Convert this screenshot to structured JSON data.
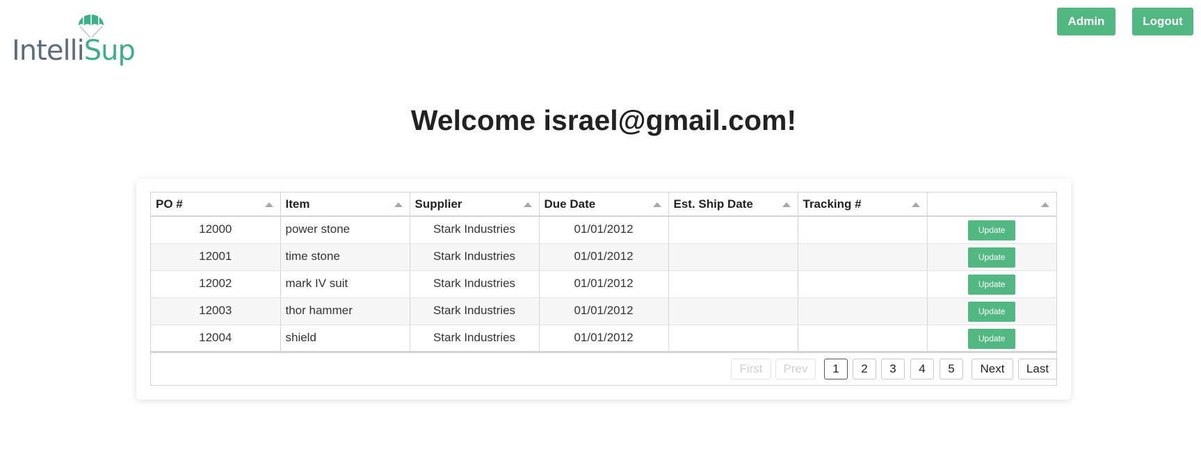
{
  "header": {
    "logo_part1": "Intelli",
    "logo_part2": "Sup",
    "admin_label": "Admin",
    "logout_label": "Logout"
  },
  "welcome": "Welcome israel@gmail.com!",
  "table": {
    "columns": [
      "PO #",
      "Item",
      "Supplier",
      "Due Date",
      "Est. Ship Date",
      "Tracking #",
      ""
    ],
    "rows": [
      {
        "po": "12000",
        "item": "power stone",
        "supplier": "Stark Industries",
        "due": "01/01/2012",
        "ship": "",
        "tracking": "",
        "action": "Update"
      },
      {
        "po": "12001",
        "item": "time stone",
        "supplier": "Stark Industries",
        "due": "01/01/2012",
        "ship": "",
        "tracking": "",
        "action": "Update"
      },
      {
        "po": "12002",
        "item": "mark IV suit",
        "supplier": "Stark Industries",
        "due": "01/01/2012",
        "ship": "",
        "tracking": "",
        "action": "Update"
      },
      {
        "po": "12003",
        "item": "thor hammer",
        "supplier": "Stark Industries",
        "due": "01/01/2012",
        "ship": "",
        "tracking": "",
        "action": "Update"
      },
      {
        "po": "12004",
        "item": "shield",
        "supplier": "Stark Industries",
        "due": "01/01/2012",
        "ship": "",
        "tracking": "",
        "action": "Update"
      }
    ]
  },
  "pagination": {
    "first": "First",
    "prev": "Prev",
    "pages": [
      "1",
      "2",
      "3",
      "4",
      "5"
    ],
    "current": "1",
    "next": "Next",
    "last": "Last"
  },
  "colors": {
    "accent": "#52b882",
    "logo_gray": "#5d6d7e",
    "logo_green": "#3db08a"
  },
  "icons": {
    "logo": "parachute-icon",
    "sort": "sort-triangle-icon"
  }
}
